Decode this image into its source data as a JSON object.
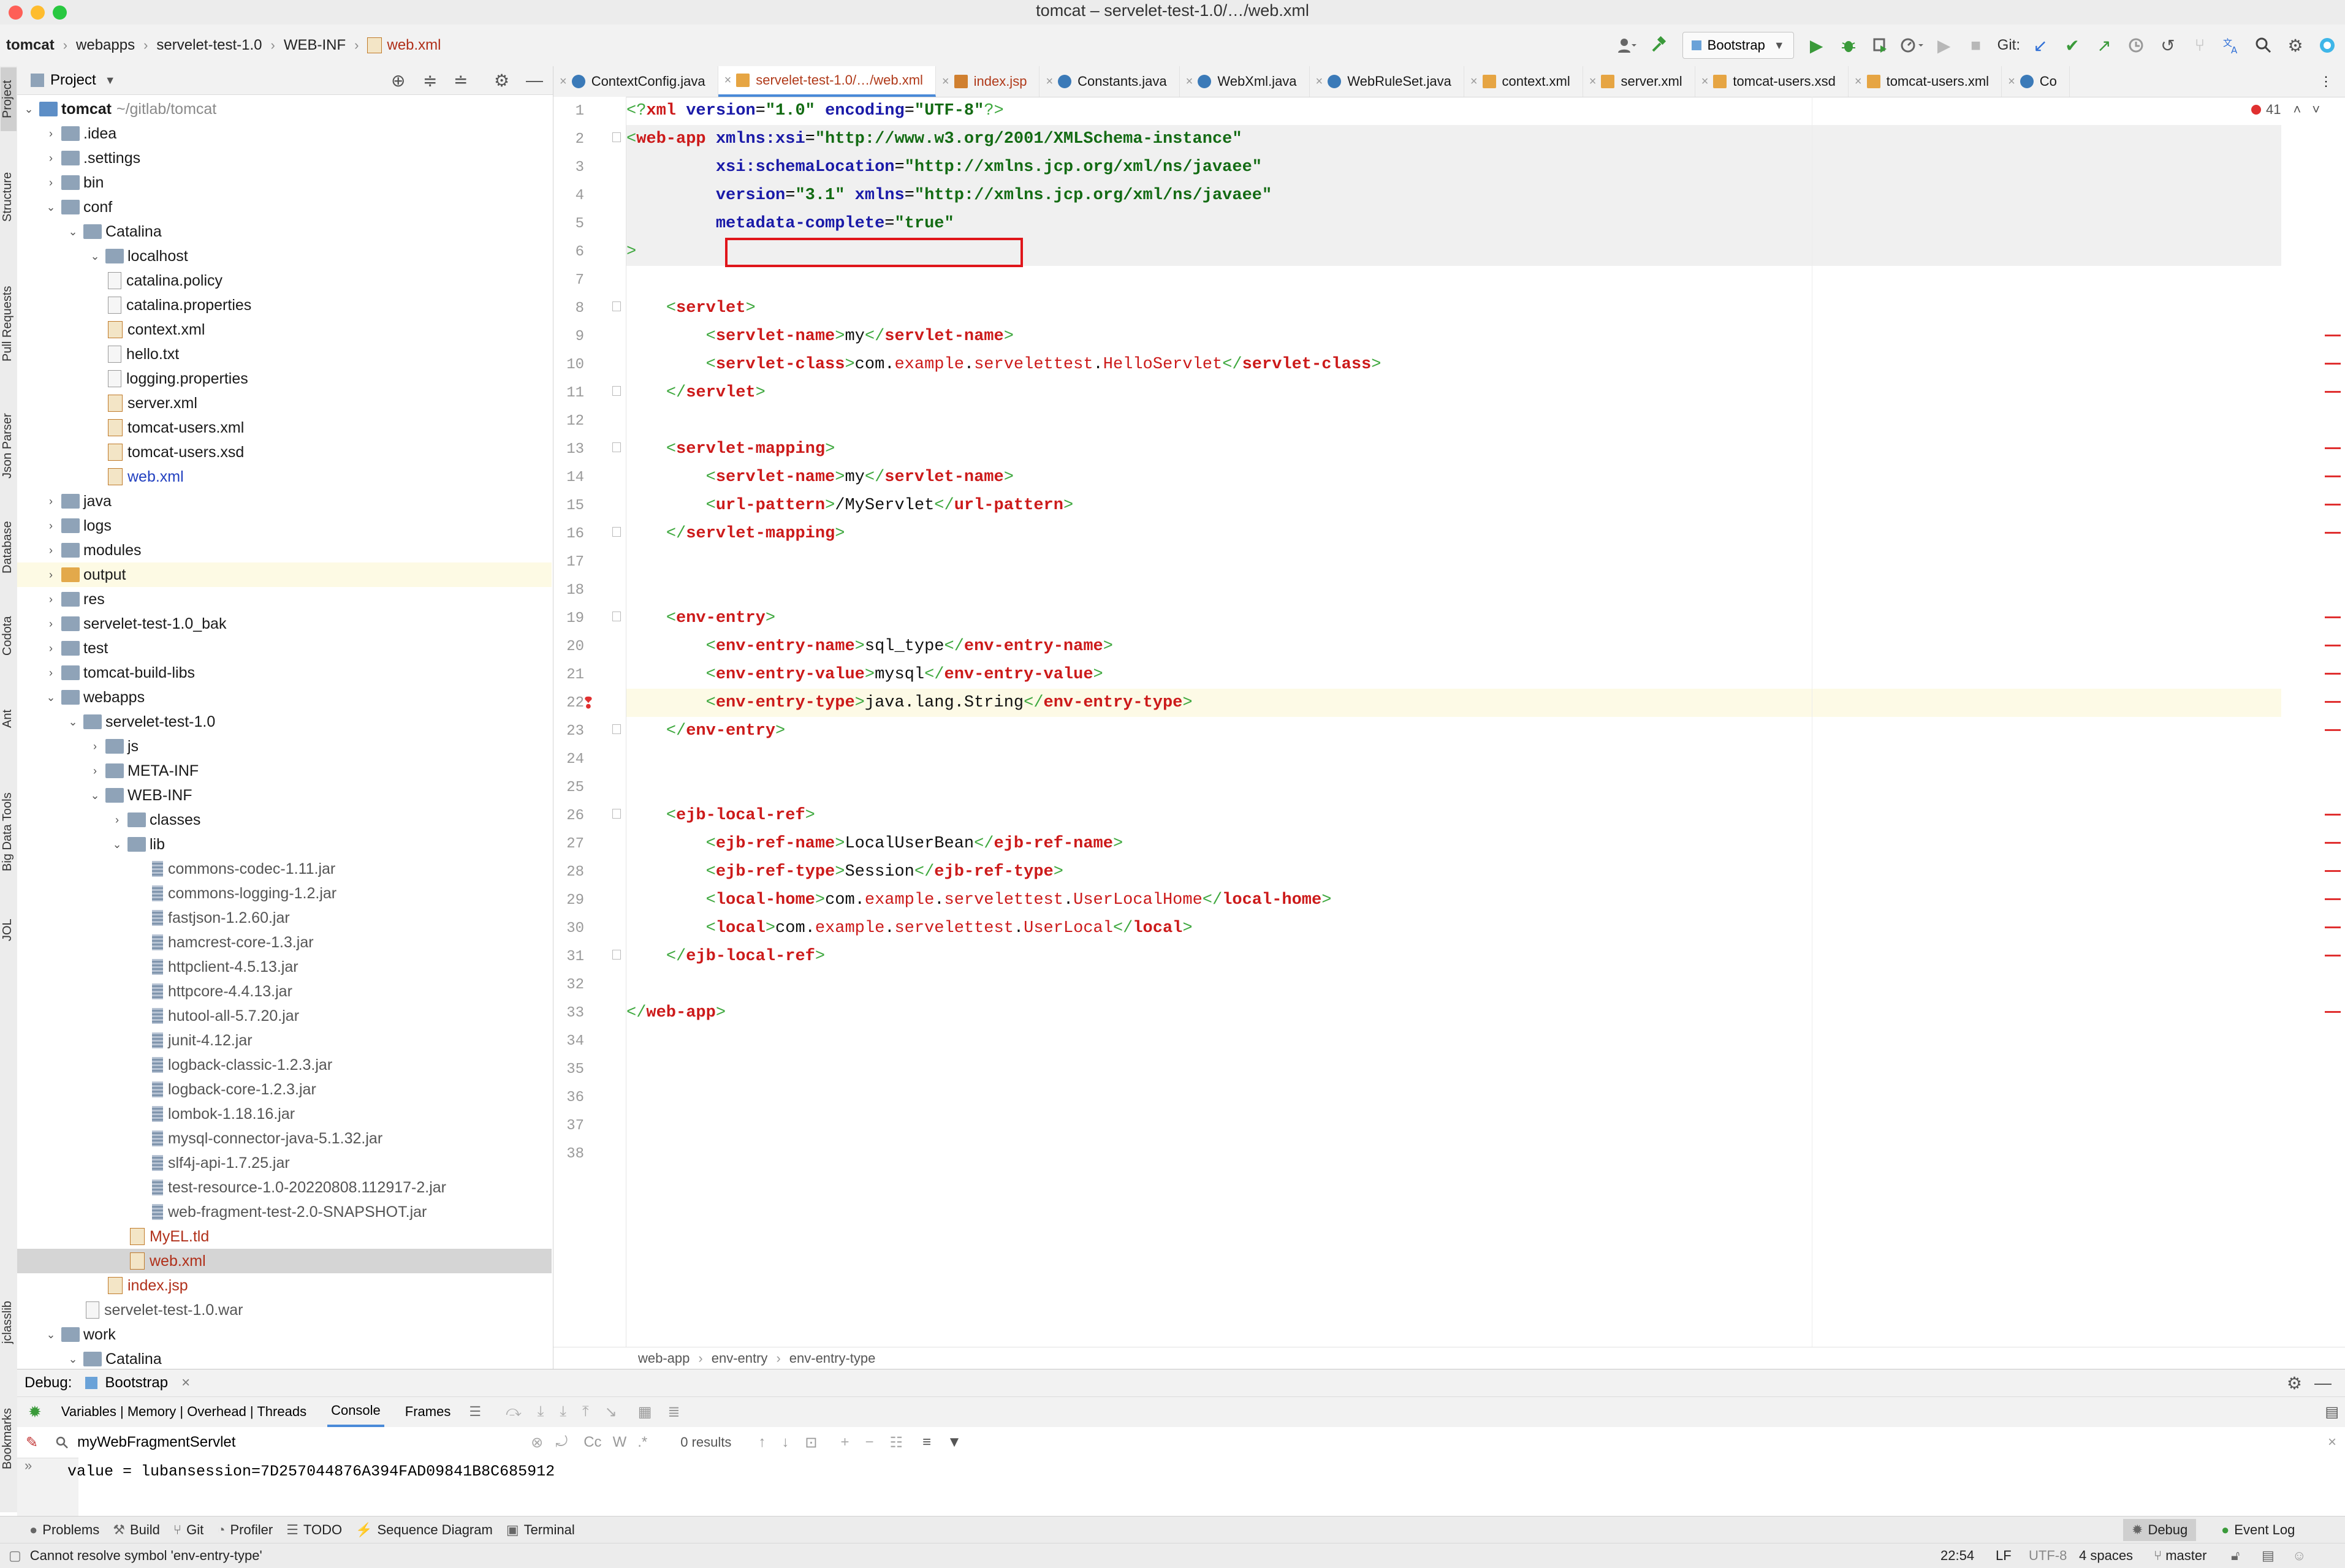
{
  "window": {
    "title": "tomcat – servelet-test-1.0/…/web.xml"
  },
  "nav": {
    "breadcrumb": [
      "tomcat",
      "webapps",
      "servelet-test-1.0",
      "WEB-INF",
      "web.xml"
    ]
  },
  "toolbar": {
    "run_config": "Bootstrap",
    "git_label": "Git:"
  },
  "side_tabs": [
    "Project",
    "Structure",
    "Pull Requests",
    "Json Parser",
    "Database",
    "Codota",
    "Ant",
    "Big Data Tools",
    "JOL",
    "jclasslib",
    "Bookmarks"
  ],
  "project": {
    "header": "Project",
    "tree": [
      {
        "label": "tomcat",
        "hint": "~/gitlab/tomcat",
        "depth": 0,
        "type": "module",
        "arrow": "open",
        "bold": true
      },
      {
        "label": ".idea",
        "depth": 1,
        "type": "folder",
        "arrow": "closed"
      },
      {
        "label": ".settings",
        "depth": 1,
        "type": "folder",
        "arrow": "closed"
      },
      {
        "label": "bin",
        "depth": 1,
        "type": "folder",
        "arrow": "closed"
      },
      {
        "label": "conf",
        "depth": 1,
        "type": "folder",
        "arrow": "open"
      },
      {
        "label": "Catalina",
        "depth": 2,
        "type": "folder",
        "arrow": "open"
      },
      {
        "label": "localhost",
        "depth": 3,
        "type": "folder",
        "arrow": "open"
      },
      {
        "label": "catalina.policy",
        "depth": 3,
        "type": "file"
      },
      {
        "label": "catalina.properties",
        "depth": 3,
        "type": "file"
      },
      {
        "label": "context.xml",
        "depth": 3,
        "type": "xml"
      },
      {
        "label": "hello.txt",
        "depth": 3,
        "type": "file"
      },
      {
        "label": "logging.properties",
        "depth": 3,
        "type": "file"
      },
      {
        "label": "server.xml",
        "depth": 3,
        "type": "xml"
      },
      {
        "label": "tomcat-users.xml",
        "depth": 3,
        "type": "xml"
      },
      {
        "label": "tomcat-users.xsd",
        "depth": 3,
        "type": "xml"
      },
      {
        "label": "web.xml",
        "depth": 3,
        "type": "xml",
        "style": "blue"
      },
      {
        "label": "java",
        "depth": 1,
        "type": "folder",
        "arrow": "closed"
      },
      {
        "label": "logs",
        "depth": 1,
        "type": "folder",
        "arrow": "closed"
      },
      {
        "label": "modules",
        "depth": 1,
        "type": "folder",
        "arrow": "closed"
      },
      {
        "label": "output",
        "depth": 1,
        "type": "folder-orange",
        "arrow": "closed",
        "style": "excluded"
      },
      {
        "label": "res",
        "depth": 1,
        "type": "folder",
        "arrow": "closed"
      },
      {
        "label": "servelet-test-1.0_bak",
        "depth": 1,
        "type": "folder",
        "arrow": "closed"
      },
      {
        "label": "test",
        "depth": 1,
        "type": "folder",
        "arrow": "closed"
      },
      {
        "label": "tomcat-build-libs",
        "depth": 1,
        "type": "folder",
        "arrow": "closed"
      },
      {
        "label": "webapps",
        "depth": 1,
        "type": "folder",
        "arrow": "open"
      },
      {
        "label": "servelet-test-1.0",
        "depth": 2,
        "type": "folder",
        "arrow": "open"
      },
      {
        "label": "js",
        "depth": 3,
        "type": "folder",
        "arrow": "closed"
      },
      {
        "label": "META-INF",
        "depth": 3,
        "type": "folder",
        "arrow": "closed"
      },
      {
        "label": "WEB-INF",
        "depth": 3,
        "type": "folder",
        "arrow": "open"
      },
      {
        "label": "classes",
        "depth": 4,
        "type": "folder",
        "arrow": "closed"
      },
      {
        "label": "lib",
        "depth": 4,
        "type": "folder",
        "arrow": "open"
      },
      {
        "label": "commons-codec-1.11.jar",
        "depth": 5,
        "type": "jar",
        "style": "gray"
      },
      {
        "label": "commons-logging-1.2.jar",
        "depth": 5,
        "type": "jar",
        "style": "gray"
      },
      {
        "label": "fastjson-1.2.60.jar",
        "depth": 5,
        "type": "jar",
        "style": "gray"
      },
      {
        "label": "hamcrest-core-1.3.jar",
        "depth": 5,
        "type": "jar",
        "style": "gray"
      },
      {
        "label": "httpclient-4.5.13.jar",
        "depth": 5,
        "type": "jar",
        "style": "gray"
      },
      {
        "label": "httpcore-4.4.13.jar",
        "depth": 5,
        "type": "jar",
        "style": "gray"
      },
      {
        "label": "hutool-all-5.7.20.jar",
        "depth": 5,
        "type": "jar",
        "style": "gray"
      },
      {
        "label": "junit-4.12.jar",
        "depth": 5,
        "type": "jar",
        "style": "gray"
      },
      {
        "label": "logback-classic-1.2.3.jar",
        "depth": 5,
        "type": "jar",
        "style": "gray"
      },
      {
        "label": "logback-core-1.2.3.jar",
        "depth": 5,
        "type": "jar",
        "style": "gray"
      },
      {
        "label": "lombok-1.18.16.jar",
        "depth": 5,
        "type": "jar",
        "style": "gray"
      },
      {
        "label": "mysql-connector-java-5.1.32.jar",
        "depth": 5,
        "type": "jar",
        "style": "gray"
      },
      {
        "label": "slf4j-api-1.7.25.jar",
        "depth": 5,
        "type": "jar",
        "style": "gray"
      },
      {
        "label": "test-resource-1.0-20220808.112917-2.jar",
        "depth": 5,
        "type": "jar",
        "style": "gray"
      },
      {
        "label": "web-fragment-test-2.0-SNAPSHOT.jar",
        "depth": 5,
        "type": "jar",
        "style": "gray"
      },
      {
        "label": "MyEL.tld",
        "depth": 4,
        "type": "xml",
        "style": "red"
      },
      {
        "label": "web.xml",
        "depth": 4,
        "type": "xml",
        "style": "red-selected"
      },
      {
        "label": "index.jsp",
        "depth": 3,
        "type": "xml",
        "style": "red"
      },
      {
        "label": "servelet-test-1.0.war",
        "depth": 2,
        "type": "file",
        "style": "gray"
      },
      {
        "label": "work",
        "depth": 1,
        "type": "folder",
        "arrow": "open"
      },
      {
        "label": "Catalina",
        "depth": 2,
        "type": "folder",
        "arrow": "open"
      }
    ]
  },
  "editor": {
    "tabs": [
      {
        "label": "ContextConfig.java",
        "icon": "class",
        "state": ""
      },
      {
        "label": "servelet-test-1.0/…/web.xml",
        "icon": "xml",
        "state": "active"
      },
      {
        "label": "index.jsp",
        "icon": "jsp",
        "state": "red"
      },
      {
        "label": "Constants.java",
        "icon": "class",
        "state": ""
      },
      {
        "label": "WebXml.java",
        "icon": "class",
        "state": ""
      },
      {
        "label": "WebRuleSet.java",
        "icon": "class",
        "state": ""
      },
      {
        "label": "context.xml",
        "icon": "xml",
        "state": ""
      },
      {
        "label": "server.xml",
        "icon": "xml",
        "state": ""
      },
      {
        "label": "tomcat-users.xsd",
        "icon": "xml",
        "state": ""
      },
      {
        "label": "tomcat-users.xml",
        "icon": "xml",
        "state": ""
      },
      {
        "label": "Co",
        "icon": "class",
        "state": ""
      }
    ],
    "inspection_count": "41",
    "breadcrumb": [
      "web-app",
      "env-entry",
      "env-entry-type"
    ],
    "lines": [
      "<?xml version=\"1.0\" encoding=\"UTF-8\"?>",
      "<web-app xmlns:xsi=\"http://www.w3.org/2001/XMLSchema-instance\"",
      "         xsi:schemaLocation=\"http://xmlns.jcp.org/xml/ns/javaee\"",
      "         version=\"3.1\" xmlns=\"http://xmlns.jcp.org/xml/ns/javaee\"",
      "         metadata-complete=\"true\"",
      ">",
      "",
      "    <servlet>",
      "        <servlet-name>my</servlet-name>",
      "        <servlet-class>com.example.servelettest.HelloServlet</servlet-class>",
      "    </servlet>",
      "",
      "    <servlet-mapping>",
      "        <servlet-name>my</servlet-name>",
      "        <url-pattern>/MyServlet</url-pattern>",
      "    </servlet-mapping>",
      "",
      "",
      "    <env-entry>",
      "        <env-entry-name>sql_type</env-entry-name>",
      "        <env-entry-value>mysql</env-entry-value>",
      "        <env-entry-type>java.lang.String</env-entry-type>",
      "    </env-entry>",
      "",
      "",
      "    <ejb-local-ref>",
      "        <ejb-ref-name>LocalUserBean</ejb-ref-name>",
      "        <ejb-ref-type>Session</ejb-ref-type>",
      "        <local-home>com.example.servelettest.UserLocalHome</local-home>",
      "        <local>com.example.servelettest.UserLocal</local>",
      "    </ejb-local-ref>",
      "",
      "</web-app>",
      "",
      "",
      "",
      "",
      ""
    ]
  },
  "debug": {
    "label": "Debug:",
    "session": "Bootstrap",
    "tabs": [
      "Variables | Memory | Overhead | Threads",
      "Console",
      "Frames"
    ],
    "search_value": "myWebFragmentServlet",
    "results": "0 results",
    "console_line": "value = lubansession=7D257044876A394FAD09841B8C685912"
  },
  "bottom_tools": [
    "Problems",
    "Build",
    "Git",
    "Profiler",
    "TODO",
    "Sequence Diagram",
    "Terminal"
  ],
  "bottom_right_tools": [
    "Debug",
    "Event Log"
  ],
  "status": {
    "message": "Cannot resolve symbol 'env-entry-type'",
    "position": "22:54",
    "line_sep": "LF",
    "encoding": "UTF-8",
    "indent": "4 spaces",
    "branch": "master"
  }
}
